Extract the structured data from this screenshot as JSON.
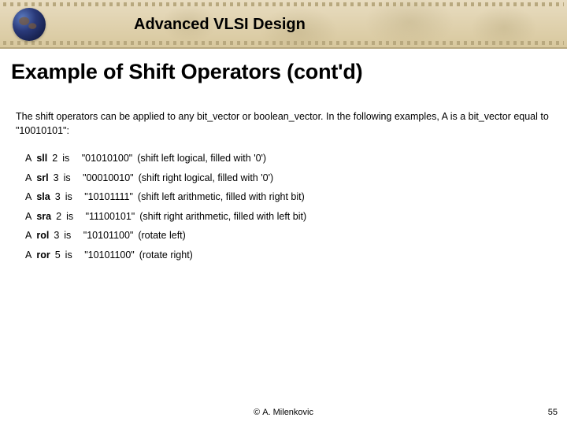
{
  "header": {
    "title": "Advanced VLSI Design"
  },
  "slide": {
    "title": "Example of Shift Operators (cont'd)",
    "intro": "The shift operators can be applied to any bit_vector or boolean_vector.  In the following examples, A is a bit_vector equal to \"10010101\":",
    "examples": [
      {
        "a": "A",
        "op": "sll",
        "n": "2",
        "is": "is",
        "val": "\"01010100\"",
        "desc": "(shift left logical, filled with '0')"
      },
      {
        "a": "A",
        "op": "srl",
        "n": "3",
        "is": "is",
        "val": "\"00010010\"",
        "desc": "(shift right logical, filled with '0')"
      },
      {
        "a": "A",
        "op": "sla",
        "n": "3",
        "is": "is",
        "val": "\"10101111\"",
        "desc": "(shift left arithmetic, filled with right bit)"
      },
      {
        "a": "A",
        "op": "sra",
        "n": "2",
        "is": "is",
        "val": "\"11100101\"",
        "desc": "(shift right arithmetic, filled with left bit)"
      },
      {
        "a": "A",
        "op": "rol",
        "n": "3",
        "is": "is",
        "val": "\"10101100\"",
        "desc": "(rotate left)"
      },
      {
        "a": "A",
        "op": "ror",
        "n": "5",
        "is": "is",
        "val": "\"10101100\"",
        "desc": "(rotate right)"
      }
    ]
  },
  "footer": {
    "copyright_symbol": "©",
    "author": "A. Milenkovic",
    "page": "55"
  }
}
